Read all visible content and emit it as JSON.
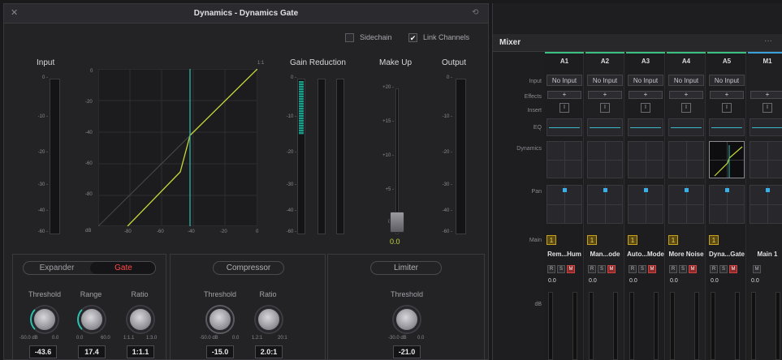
{
  "dyn": {
    "title": "Dynamics - Dynamics Gate",
    "sidechain": "Sidechain",
    "link": "Link Channels",
    "input": "Input",
    "gain_reduction": "Gain Reduction",
    "makeup": "Make Up",
    "output": "Output",
    "meter_ticks": [
      "0 -",
      "-10 -",
      "-20 -",
      "-30 -",
      "-40 -",
      "-60 -"
    ],
    "graph_y": [
      "0",
      "-20",
      "-40",
      "-60",
      "-80",
      "dB"
    ],
    "graph_x": [
      "-80",
      "-60",
      "-40",
      "-20",
      "0"
    ],
    "graph_ratio": "1:1",
    "mu_ticks": [
      "+20 -",
      "+15 -",
      "+10 -",
      "+5 -",
      "0 -"
    ],
    "makeup_value": "0.0",
    "expander": "Expander",
    "gate": "Gate",
    "compressor": "Compressor",
    "limiter": "Limiter",
    "threshold": "Threshold",
    "range": "Range",
    "ratio": "Ratio",
    "g_thr_range": [
      "-50.0 dB",
      "0.0"
    ],
    "g_rng_range": [
      "0.0",
      "60.0"
    ],
    "g_rat_range": [
      "1:1.1",
      "1:3.0"
    ],
    "c_thr_range": [
      "-50.0 dB",
      "0.0"
    ],
    "c_rat_range": [
      "1.2:1",
      "20:1"
    ],
    "l_thr_range": [
      "-30.0 dB",
      "0.0"
    ],
    "g_thr_val": "-43.6",
    "g_rng_val": "17.4",
    "g_rat_val": "1:1.1",
    "c_thr_val": "-15.0",
    "c_rat_val": "2.0:1",
    "l_thr_val": "-21.0"
  },
  "mixer": {
    "title": "Mixer",
    "menu": "···",
    "channels": [
      "A1",
      "A2",
      "A3",
      "A4",
      "A5",
      "M1"
    ],
    "rows": [
      "Input",
      "Effects",
      "Insert",
      "EQ",
      "Dynamics",
      "Pan",
      "Main",
      "dB"
    ],
    "no_input": "No Input",
    "plus": "+",
    "insert": "I",
    "main_assign": "1",
    "names": [
      "Rem...Hum",
      "Man...ode",
      "Auto...Mode",
      "More Noise",
      "Dyna...Gate",
      "Main 1"
    ],
    "r": "R",
    "s": "S",
    "m": "M",
    "db_val": "0.0"
  }
}
